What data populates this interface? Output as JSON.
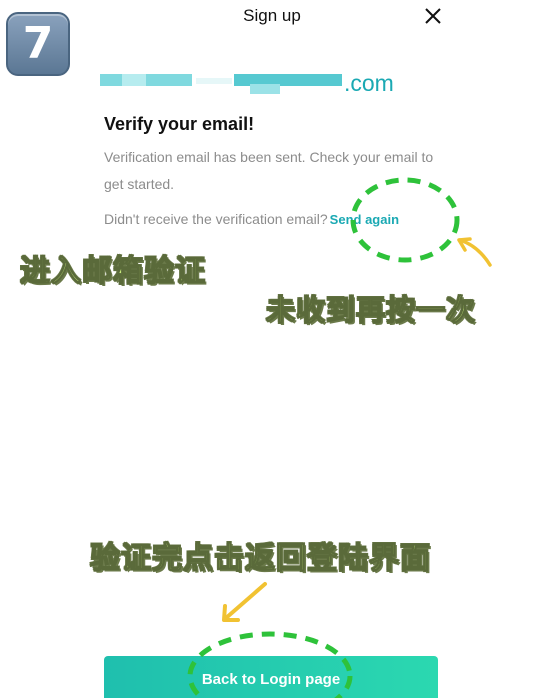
{
  "step_badge": "7",
  "header": {
    "title": "Sign up",
    "close_icon": "close-icon"
  },
  "email": {
    "domain": ".com",
    "accent": "#1aa9b3"
  },
  "verify": {
    "title": "Verify your email!",
    "description": "Verification email has been sent. Check your email to get started.",
    "resend_prompt": "Didn't receive the verification email?",
    "send_again": "Send again"
  },
  "annotations": {
    "enter_mailbox": "进入邮箱验证",
    "resend_hint": "未收到再按一次",
    "return_hint": "验证完点击返回登陆界面"
  },
  "button": {
    "label": "Back to Login page",
    "color": "#22c9b0"
  }
}
